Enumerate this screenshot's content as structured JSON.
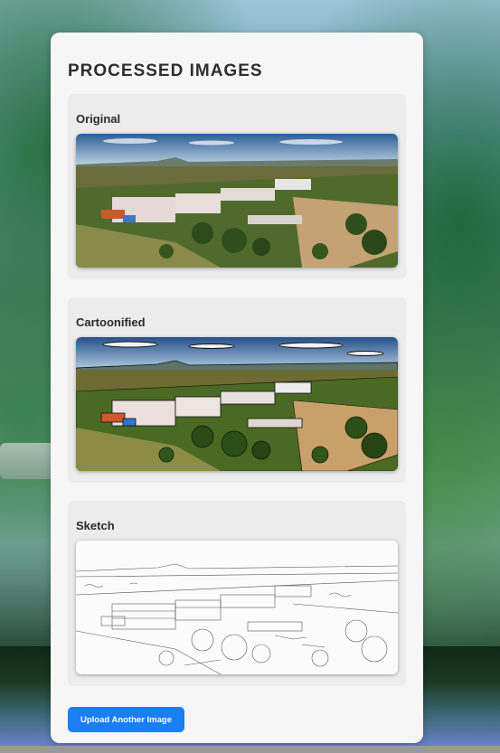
{
  "panel": {
    "title": "PROCESSED IMAGES"
  },
  "cards": [
    {
      "label": "Original",
      "image": "campus-aerial-photo"
    },
    {
      "label": "Cartoonified",
      "image": "campus-aerial-cartoon"
    },
    {
      "label": "Sketch",
      "image": "campus-aerial-sketch"
    }
  ],
  "actions": {
    "upload_label": "Upload Another Image"
  },
  "colors": {
    "accent": "#1a7ff0",
    "panel_bg": "#f6f6f6",
    "card_bg": "#ececec"
  }
}
